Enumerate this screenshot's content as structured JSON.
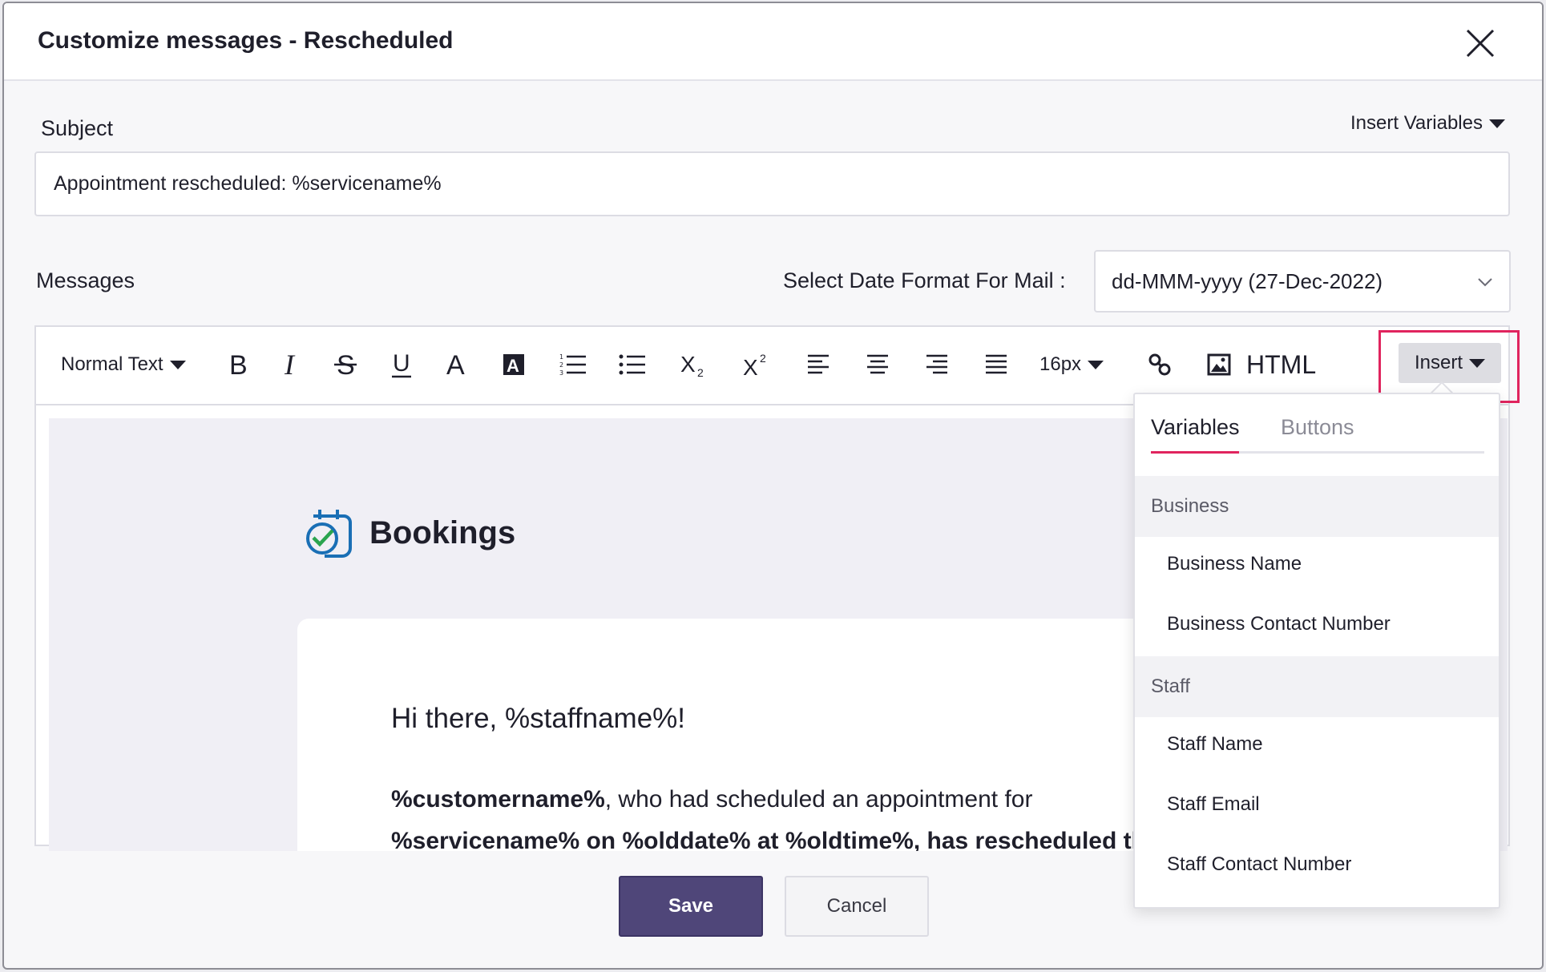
{
  "dialog": {
    "title": "Customize messages - Rescheduled"
  },
  "subject": {
    "label": "Subject",
    "insert_variables": "Insert Variables",
    "value": "Appointment rescheduled: %servicename%"
  },
  "messages": {
    "label": "Messages",
    "date_format_label": "Select Date Format For Mail :",
    "date_format_value": "dd-MMM-yyyy (27-Dec-2022)"
  },
  "toolbar": {
    "format": "Normal Text",
    "font_size": "16px",
    "html": "HTML",
    "insert": "Insert",
    "icons": [
      "bold-icon",
      "italic-icon",
      "strikethrough-icon",
      "underline-icon",
      "font-color-icon",
      "highlight-color-icon",
      "ordered-list-icon",
      "unordered-list-icon",
      "subscript-icon",
      "superscript-icon",
      "align-left-icon",
      "align-center-icon",
      "align-right-icon",
      "justify-icon",
      "link-icon",
      "image-icon"
    ]
  },
  "preview": {
    "brand": "Bookings",
    "greeting": "Hi there, %staffname%!",
    "para_bold1": "%customername%",
    "para_text1": ", who had scheduled an appointment for",
    "para_line2": "%servicename% on %olddate% at %oldtime%, has rescheduled the"
  },
  "dropdown": {
    "tab_variables": "Variables",
    "tab_buttons": "Buttons",
    "sections": [
      {
        "title": "Business",
        "items": [
          "Business Name",
          "Business Contact Number"
        ]
      },
      {
        "title": "Staff",
        "items": [
          "Staff Name",
          "Staff Email",
          "Staff Contact Number"
        ]
      }
    ]
  },
  "actions": {
    "save": "Save",
    "cancel": "Cancel"
  },
  "colors": {
    "primary": "#4f4679",
    "highlight": "#e0245e",
    "brand_blue": "#1a6fb5",
    "brand_green": "#2aa44f"
  }
}
